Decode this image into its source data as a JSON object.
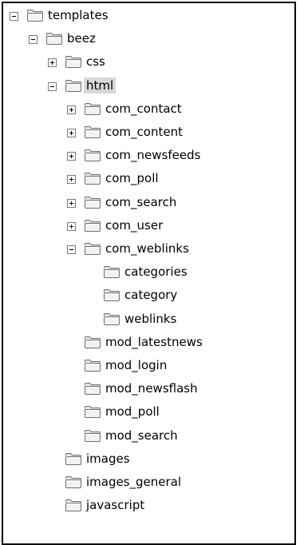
{
  "tree": {
    "nodes": [
      {
        "label": "templates",
        "depth": 0,
        "expander": "minus"
      },
      {
        "label": "beez",
        "depth": 1,
        "expander": "minus"
      },
      {
        "label": "css",
        "depth": 2,
        "expander": "plus"
      },
      {
        "label": "html",
        "depth": 2,
        "expander": "minus",
        "selected": true
      },
      {
        "label": "com_contact",
        "depth": 3,
        "expander": "plus"
      },
      {
        "label": "com_content",
        "depth": 3,
        "expander": "plus"
      },
      {
        "label": "com_newsfeeds",
        "depth": 3,
        "expander": "plus"
      },
      {
        "label": "com_poll",
        "depth": 3,
        "expander": "plus"
      },
      {
        "label": "com_search",
        "depth": 3,
        "expander": "plus"
      },
      {
        "label": "com_user",
        "depth": 3,
        "expander": "plus"
      },
      {
        "label": "com_weblinks",
        "depth": 3,
        "expander": "minus"
      },
      {
        "label": "categories",
        "depth": 4,
        "expander": "none"
      },
      {
        "label": "category",
        "depth": 4,
        "expander": "none"
      },
      {
        "label": "weblinks",
        "depth": 4,
        "expander": "none"
      },
      {
        "label": "mod_latestnews",
        "depth": 3,
        "expander": "none"
      },
      {
        "label": "mod_login",
        "depth": 3,
        "expander": "none"
      },
      {
        "label": "mod_newsflash",
        "depth": 3,
        "expander": "none"
      },
      {
        "label": "mod_poll",
        "depth": 3,
        "expander": "none"
      },
      {
        "label": "mod_search",
        "depth": 3,
        "expander": "none"
      },
      {
        "label": "images",
        "depth": 2,
        "expander": "none"
      },
      {
        "label": "images_general",
        "depth": 2,
        "expander": "none"
      },
      {
        "label": "javascript",
        "depth": 2,
        "expander": "none"
      }
    ]
  }
}
